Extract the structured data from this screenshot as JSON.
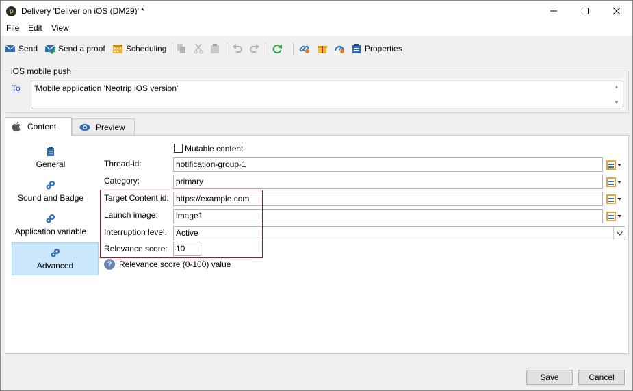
{
  "window": {
    "title": "Delivery 'Deliver on iOS (DM29)' *",
    "app_icon_glyph": "p"
  },
  "menu": [
    "File",
    "Edit",
    "View"
  ],
  "toolbar": {
    "send": "Send",
    "send_proof": "Send a proof",
    "scheduling": "Scheduling",
    "properties": "Properties"
  },
  "recipients": {
    "group_title": "iOS mobile push",
    "to_label": "To",
    "to_value": "'Mobile application 'Neotrip iOS version''"
  },
  "tabs": [
    {
      "label": "Content",
      "icon": "apple-icon",
      "active": true
    },
    {
      "label": "Preview",
      "icon": "eye-icon",
      "active": false
    }
  ],
  "sidebar": [
    {
      "label": "General",
      "icon": "clipboard-icon"
    },
    {
      "label": "Sound and Badge",
      "icon": "gears-icon"
    },
    {
      "label": "Application variable",
      "icon": "gears-icon"
    },
    {
      "label": "Advanced",
      "icon": "gears-icon",
      "selected": true
    }
  ],
  "form": {
    "mutable_content": {
      "label": "Mutable content",
      "checked": false
    },
    "thread_id": {
      "label": "Thread-id:",
      "value": "notification-group-1"
    },
    "category": {
      "label": "Category:",
      "value": "primary"
    },
    "target_content_id": {
      "label": "Target Content id:",
      "value": "https://example.com"
    },
    "launch_image": {
      "label": "Launch image:",
      "value": "image1"
    },
    "interruption_level": {
      "label": "Interruption level:",
      "value": "Active"
    },
    "relevance_score": {
      "label": "Relevance score:",
      "value": "10"
    },
    "help_text": "Relevance score (0-100) value"
  },
  "footer": {
    "save": "Save",
    "cancel": "Cancel"
  },
  "colors": {
    "highlight_border": "#9b1b1b",
    "selected_item_bg": "#cce8ff",
    "link": "#1a47c2"
  }
}
